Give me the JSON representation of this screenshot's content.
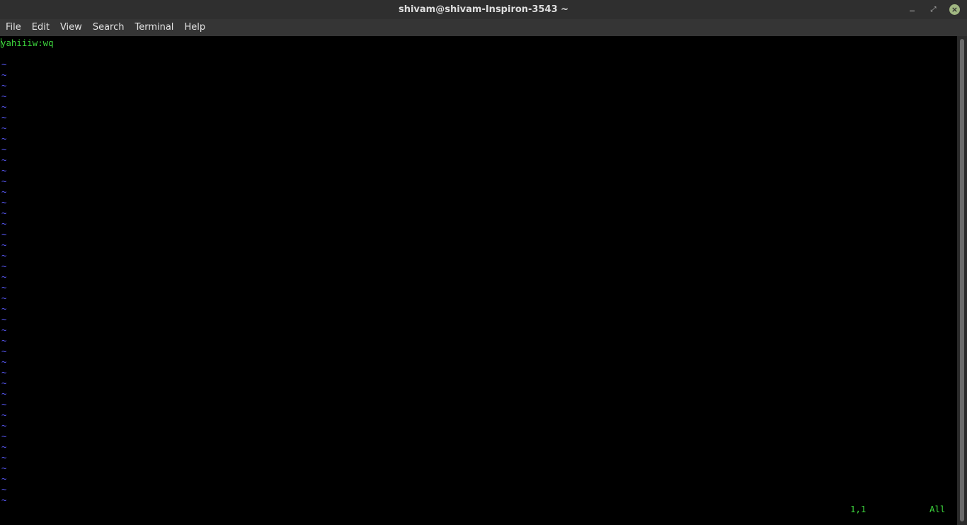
{
  "window": {
    "title": "shivam@shivam-Inspiron-3543 ~",
    "minimize_glyph": "",
    "maximize_glyph": "⤢",
    "close_glyph": "×"
  },
  "menu": {
    "items": [
      {
        "label": "File"
      },
      {
        "label": "Edit"
      },
      {
        "label": "View"
      },
      {
        "label": "Search"
      },
      {
        "label": "Terminal"
      },
      {
        "label": "Help"
      }
    ]
  },
  "editor": {
    "buffer_line": "yahiiiw:wq",
    "empty_line_marker": "~",
    "empty_line_count": 42,
    "cursor_position": "1,1",
    "scroll_position": "All"
  },
  "colors": {
    "text": "#3cd33c",
    "tilde": "#5b5bff",
    "background": "#000000",
    "titlebar": "#2f2f2f",
    "menubar": "#353535",
    "close_accent": "#a1b782"
  }
}
